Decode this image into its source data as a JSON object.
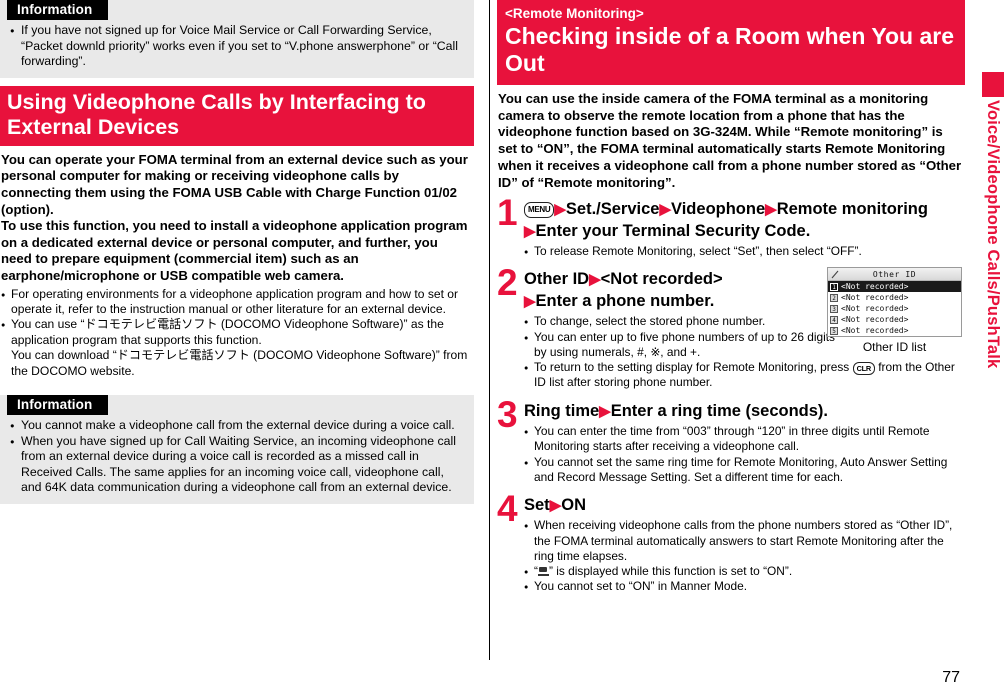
{
  "page": {
    "number": "77",
    "side_tab": "Voice/Videophone Calls/PushTalk",
    "accent_color": "#e8123c"
  },
  "left_column": {
    "info_top": {
      "tab_label": "Information",
      "items": [
        "If you have not signed up for Voice Mail Service or Call Forwarding Service, “Packet downld priority” works even if you set to “V.phone answerphone” or “Call forwarding”."
      ]
    },
    "section_banner": {
      "line1": "Using Videophone Calls by Interfacing to",
      "line2": "External Devices"
    },
    "body": [
      "You can operate your FOMA terminal from an external device such as your personal computer for making or receiving videophone calls by connecting them using the FOMA USB Cable with Charge Function 01/02 (option).",
      "To use this function, you need to install a videophone application program on a dedicated external device or personal computer, and further, you need to prepare equipment (commercial item) such as an earphone/microphone or USB compatible web camera."
    ],
    "notes": [
      {
        "text": "For operating environments for a videophone application program and how to set or operate it, refer to the instruction manual or other literature for an external device."
      },
      {
        "text": "You can use “ドコモテレビ電話ソフト (DOCOMO Videophone Software)” as the application program that supports this function.",
        "sub": "You can download “ドコモテレビ電話ソフト (DOCOMO Videophone Software)” from the DOCOMO website."
      }
    ],
    "info_bottom": {
      "tab_label": "Information",
      "items": [
        "You cannot make a videophone call from the external device during a voice call.",
        "When you have signed up for Call Waiting Service, an incoming videophone call from an external device during a voice call is recorded as a missed call in Received Calls. The same applies for an incoming voice call, videophone call, and 64K data communication during a videophone call from an external device."
      ]
    }
  },
  "right_column": {
    "banner": {
      "tag": "<Remote Monitoring>",
      "title": "Checking inside of a Room when You are Out"
    },
    "intro": "You can use the inside camera of the FOMA terminal as a monitoring camera to observe the remote location from a phone that has the videophone function based on 3G-324M. While “Remote monitoring” is set to “ON”, the FOMA terminal automatically starts Remote Monitoring when it receives a videophone call from a phone number stored as “Other ID” of “Remote monitoring”.",
    "steps": [
      {
        "number": "1",
        "key_label": "MENU",
        "head_line1_parts": [
          "Set./Service",
          "Videophone",
          "Remote monitoring"
        ],
        "head_line2": "Enter your Terminal Security Code.",
        "notes": [
          "To release Remote Monitoring, select “Set”, then select “OFF”."
        ]
      },
      {
        "number": "2",
        "head_line1_a": "Other ID",
        "head_line1_b": "<Not recorded>",
        "head_line2": "Enter a phone number.",
        "notes": [
          "To change, select the stored phone number.",
          "You can enter up to five phone numbers of up to 26 digits by using numerals, #, ※, and +.",
          "To return to the setting display for Remote Monitoring, press  from the Other ID list after storing phone number."
        ],
        "note3_pre": "To return to the setting display for Remote Monitoring, press",
        "note3_key": "CLR",
        "note3_post": "from the Other ID list after storing phone number."
      },
      {
        "number": "3",
        "head_a": "Ring time",
        "head_b": "Enter a ring time (seconds).",
        "notes": [
          "You can enter the time from “003” through “120” in three digits until Remote Monitoring starts after receiving a videophone call.",
          "You cannot set the same ring time for Remote Monitoring, Auto Answer Setting and Record Message Setting. Set a different time for each."
        ]
      },
      {
        "number": "4",
        "head_a": "Set",
        "head_b": "ON",
        "notes": [
          "When receiving videophone calls from the phone numbers stored as “Other ID”, the FOMA terminal automatically answers to start Remote Monitoring after the ring time elapses.",
          "” is displayed while this function is set to “ON”.",
          "You cannot set to “ON” in Manner Mode."
        ],
        "note2_pre": "“",
        "note2_post": "” is displayed while this function is set to “ON”."
      }
    ],
    "phone_screen": {
      "title": "Other ID",
      "rows": [
        {
          "index": "1",
          "label": "<Not recorded>",
          "selected": true
        },
        {
          "index": "2",
          "label": "<Not recorded>",
          "selected": false
        },
        {
          "index": "3",
          "label": "<Not recorded>",
          "selected": false
        },
        {
          "index": "4",
          "label": "<Not recorded>",
          "selected": false
        },
        {
          "index": "5",
          "label": "<Not recorded>",
          "selected": false
        }
      ],
      "caption": "Other ID list"
    }
  }
}
